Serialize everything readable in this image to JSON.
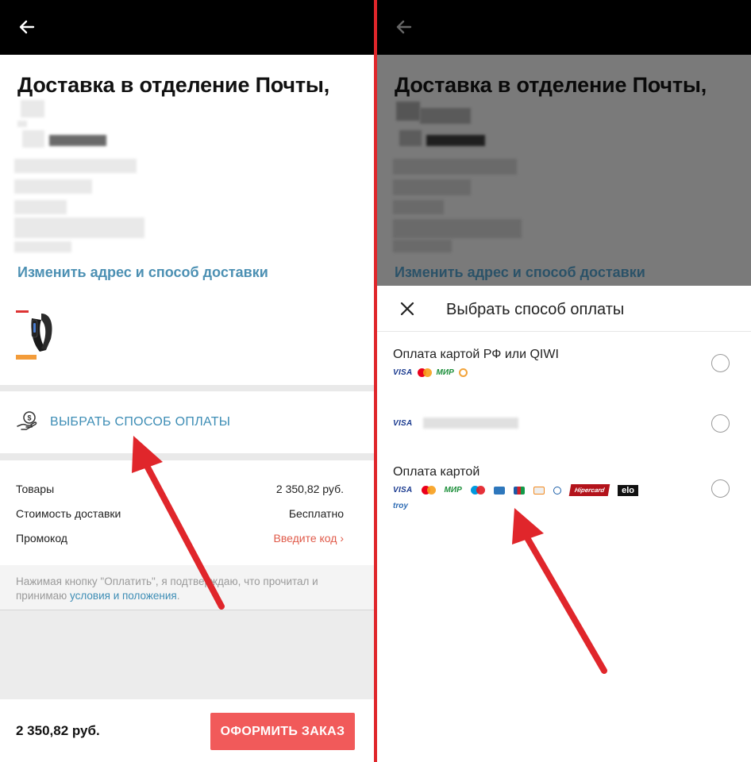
{
  "left": {
    "address_title": "Доставка в отделение Почты,",
    "change_link": "Изменить адрес и способ доставки",
    "pay_method_label": "ВЫБРАТЬ СПОСОБ ОПЛАТЫ",
    "summary": {
      "goods_label": "Товары",
      "goods_value": "2 350,82 руб.",
      "delivery_label": "Стоимость доставки",
      "delivery_value": "Бесплатно",
      "promo_label": "Промокод",
      "promo_value": "Введите код ›"
    },
    "terms_text": "Нажимая кнопку \"Оплатить\", я подтверждаю, что прочитал и принимаю ",
    "terms_link": "условия и положения",
    "terms_end": ".",
    "total": "2 350,82 руб.",
    "order_button": "ОФОРМИТЬ ЗАКАЗ"
  },
  "right": {
    "address_title": "Доставка в отделение Почты,",
    "change_link": "Изменить адрес и способ доставки",
    "sheet_title": "Выбрать способ оплаты",
    "options": [
      {
        "title": "Оплата картой РФ или QIWI",
        "logos": [
          "VISA",
          "mastercard-logo",
          "МИР",
          "qiwi-logo"
        ]
      },
      {
        "title": "",
        "logos": [
          "VISA"
        ]
      },
      {
        "title": "Оплата картой",
        "logos": [
          "VISA",
          "mastercard-logo",
          "МИР",
          "maestro-logo",
          "amex-logo",
          "jcb-logo",
          "discover-logo",
          "diners-logo",
          "Hipercard",
          "elo",
          "troy"
        ]
      }
    ]
  },
  "colors": {
    "accent_link": "#3d8db5",
    "order_button": "#f15a5a",
    "annotation_arrow": "#e0262b",
    "divider": "#e0262b"
  }
}
